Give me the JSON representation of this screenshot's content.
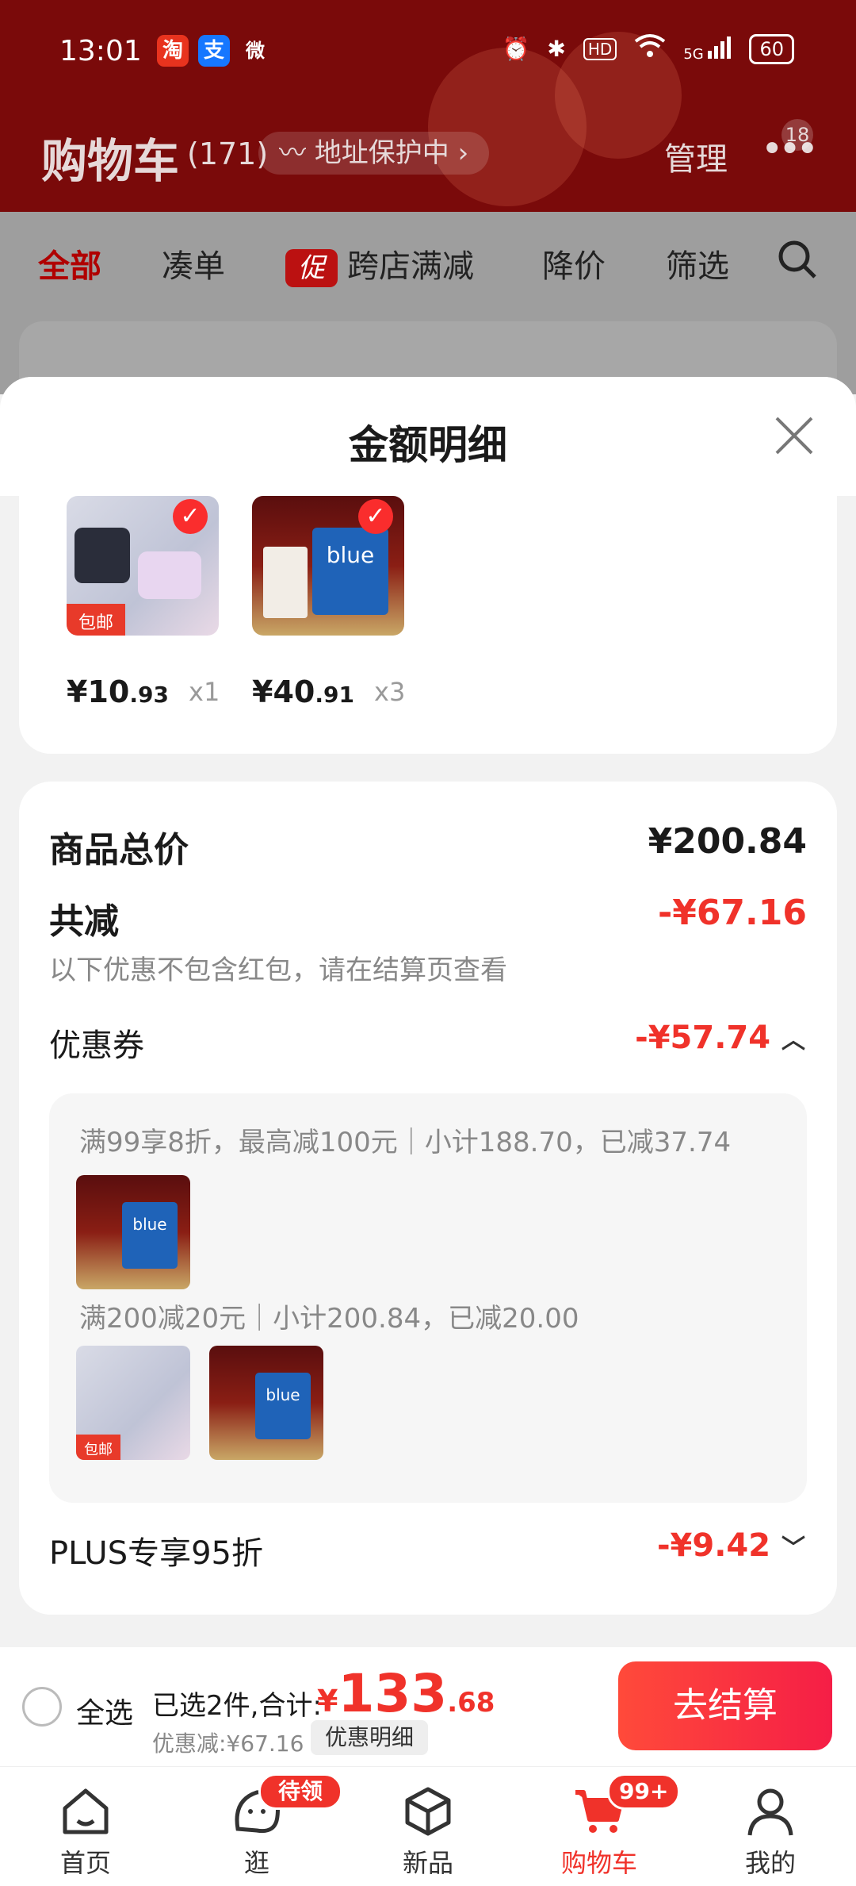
{
  "status_bar": {
    "time": "13:01",
    "apps": [
      "淘",
      "支",
      "微"
    ],
    "network": "5G",
    "battery": "60"
  },
  "header": {
    "title": "购物车",
    "count": "(171)",
    "address": "地址保护中",
    "manage": "管理",
    "more_badge": "18"
  },
  "filters": {
    "all": "全部",
    "bundle": "凑单",
    "promo_tag": "促",
    "cross_store": "跨店满减",
    "price_drop": "降价",
    "filter": "筛选"
  },
  "sheet": {
    "title": "金额明细",
    "items": [
      {
        "price_int": "¥10",
        "price_dec": ".93",
        "qty": "x1"
      },
      {
        "price_int": "¥40",
        "price_dec": ".91",
        "qty": "x3"
      }
    ],
    "item_tag": "包邮",
    "total_label": "商品总价",
    "total_value": "¥200.84",
    "reduce_label": "共减",
    "reduce_value": "-¥67.16",
    "reduce_note": "以下优惠不包含红包，请在结算页查看",
    "coupon_label": "优惠券",
    "coupon_value": "-¥57.74",
    "coupon_rules": [
      {
        "text": "满99享8折，最高减100元｜小计188.70，已减37.74"
      },
      {
        "text": "满200减20元｜小计200.84，已减20.00"
      }
    ],
    "plus_label": "PLUS专享95折",
    "plus_value": "-¥9.42"
  },
  "checkout": {
    "select_all": "全选",
    "summary": "已选2件,合计:",
    "currency": "¥",
    "total_int": "133",
    "total_dec": ".68",
    "discount": "优惠减:¥67.16",
    "detail_button": "优惠明细",
    "go_button": "去结算"
  },
  "tabbar": {
    "items": [
      {
        "label": "首页"
      },
      {
        "label": "逛",
        "badge": "待领取"
      },
      {
        "label": "新品"
      },
      {
        "label": "购物车",
        "badge": "99+"
      },
      {
        "label": "我的"
      }
    ]
  },
  "colors": {
    "accent": "#f0322a",
    "header_bg": "#7a0a0a"
  }
}
